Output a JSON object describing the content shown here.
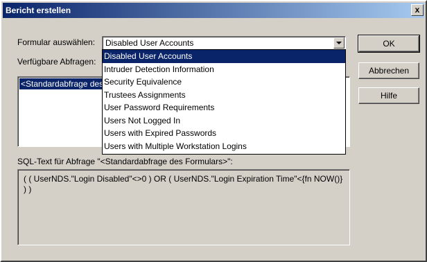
{
  "window": {
    "title": "Bericht erstellen",
    "close_label": "x"
  },
  "form": {
    "select_label": "Formular auswählen:",
    "selected_value": "Disabled User Accounts",
    "queries_label": "Verfügbare Abfragen:",
    "sql_label": "SQL-Text für Abfrage \"<Standardabfrage des Formulars>\":",
    "sql_text": "( ( UserNDS.\"Login Disabled\"<>0 ) OR  ( UserNDS.\"Login Expiration Time\"<{fn NOW()} ) )"
  },
  "dropdown": {
    "items": [
      "Disabled User Accounts",
      "Intruder Detection Information",
      "Security Equivalence",
      "Trustees Assignments",
      "User Password Requirements",
      "Users Not Logged In",
      "Users with Expired Passwords",
      "Users with Multiple Workstation Logins"
    ],
    "selected_index": 0
  },
  "queries": {
    "items": [
      "<Standardabfrage des Formulars>"
    ]
  },
  "buttons": {
    "ok": "OK",
    "cancel": "Abbrechen",
    "help": "Hilfe"
  },
  "colors": {
    "selection": "#0a246a",
    "face": "#d4d0c8"
  }
}
